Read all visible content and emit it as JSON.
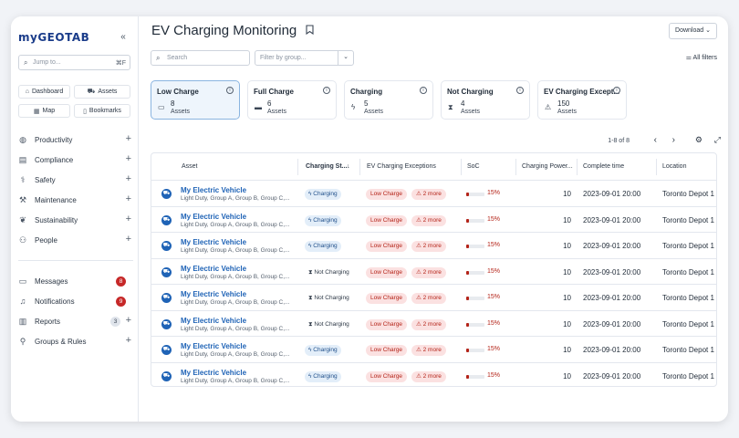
{
  "sidebar": {
    "logo": "myGEOTAB",
    "collapse_icon": "«",
    "jump": {
      "placeholder": "Jump to...",
      "shortcut": "⌘F"
    },
    "quick": [
      {
        "label": "Dashboard",
        "icon": "home-icon"
      },
      {
        "label": "Assets",
        "icon": "truck-icon"
      },
      {
        "label": "Map",
        "icon": "map-icon"
      },
      {
        "label": "Bookmarks",
        "icon": "bookmark-icon"
      }
    ],
    "nav": [
      {
        "label": "Productivity",
        "icon": "globe-icon"
      },
      {
        "label": "Compliance",
        "icon": "clipboard-icon"
      },
      {
        "label": "Safety",
        "icon": "safety-icon"
      },
      {
        "label": "Maintenance",
        "icon": "wrench-icon"
      },
      {
        "label": "Sustainability",
        "icon": "leaf-icon"
      },
      {
        "label": "People",
        "icon": "people-icon"
      }
    ],
    "nav2": [
      {
        "label": "Messages",
        "icon": "message-icon",
        "badge": "8"
      },
      {
        "label": "Notifications",
        "icon": "bell-icon",
        "badge": "9"
      },
      {
        "label": "Reports",
        "icon": "report-icon",
        "badge": "3"
      },
      {
        "label": "Groups & Rules",
        "icon": "groups-icon"
      }
    ]
  },
  "header": {
    "title": "EV Charging Monitoring",
    "download": "Download",
    "search_placeholder": "Search",
    "filter_placeholder": "Filter by group...",
    "all_filters": "All filters"
  },
  "cards": [
    {
      "label": "Low Charge",
      "count": "8",
      "unit": "Assets",
      "icon": "battery-low-icon"
    },
    {
      "label": "Full Charge",
      "count": "6",
      "unit": "Assets",
      "icon": "battery-full-icon"
    },
    {
      "label": "Charging",
      "count": "5",
      "unit": "Assets",
      "icon": "battery-charging-icon"
    },
    {
      "label": "Not Charging",
      "count": "4",
      "unit": "Assets",
      "icon": "hourglass-icon"
    },
    {
      "label": "EV Charging Except...",
      "count": "150",
      "unit": "Assets",
      "icon": "warning-icon"
    }
  ],
  "pager": {
    "text": "1-8 of 8"
  },
  "table": {
    "columns": [
      "Asset",
      "Charging St...",
      "EV Charging Exceptions",
      "SoC",
      "Charging Power...",
      "Complete time",
      "Location"
    ],
    "rows": [
      {
        "name": "My Electric Vehicle",
        "group": "Light Duty, Group A, Group B, Group C,...",
        "status": "Charging",
        "status_type": "charging",
        "exception": "Low Charge",
        "more": "2 more",
        "soc": "15%",
        "soc_value": 0.15,
        "power": "10",
        "time": "2023-09-01 20:00",
        "location": "Toronto Depot 1"
      },
      {
        "name": "My Electric Vehicle",
        "group": "Light Duty, Group A, Group B, Group C,...",
        "status": "Charging",
        "status_type": "charging",
        "exception": "Low Charge",
        "more": "2 more",
        "soc": "15%",
        "soc_value": 0.15,
        "power": "10",
        "time": "2023-09-01 20:00",
        "location": "Toronto Depot 1"
      },
      {
        "name": "My Electric Vehicle",
        "group": "Light Duty, Group A, Group B, Group C,...",
        "status": "Charging",
        "status_type": "charging",
        "exception": "Low Charge",
        "more": "2 more",
        "soc": "15%",
        "soc_value": 0.15,
        "power": "10",
        "time": "2023-09-01 20:00",
        "location": "Toronto Depot 1"
      },
      {
        "name": "My Electric Vehicle",
        "group": "Light Duty, Group A, Group B, Group C,...",
        "status": "Not Charging",
        "status_type": "notcharging",
        "exception": "Low Charge",
        "more": "2 more",
        "soc": "15%",
        "soc_value": 0.15,
        "power": "10",
        "time": "2023-09-01 20:00",
        "location": "Toronto Depot 1"
      },
      {
        "name": "My Electric Vehicle",
        "group": "Light Duty, Group A, Group B, Group C,...",
        "status": "Not Charging",
        "status_type": "notcharging",
        "exception": "Low Charge",
        "more": "2 more",
        "soc": "15%",
        "soc_value": 0.15,
        "power": "10",
        "time": "2023-09-01 20:00",
        "location": "Toronto Depot 1"
      },
      {
        "name": "My Electric Vehicle",
        "group": "Light Duty, Group A, Group B, Group C,...",
        "status": "Not Charging",
        "status_type": "notcharging",
        "exception": "Low Charge",
        "more": "2 more",
        "soc": "15%",
        "soc_value": 0.15,
        "power": "10",
        "time": "2023-09-01 20:00",
        "location": "Toronto Depot 1"
      },
      {
        "name": "My Electric Vehicle",
        "group": "Light Duty, Group A, Group B, Group C,...",
        "status": "Charging",
        "status_type": "charging",
        "exception": "Low Charge",
        "more": "2 more",
        "soc": "15%",
        "soc_value": 0.15,
        "power": "10",
        "time": "2023-09-01 20:00",
        "location": "Toronto Depot 1"
      },
      {
        "name": "My Electric Vehicle",
        "group": "Light Duty, Group A, Group B, Group C,...",
        "status": "Charging",
        "status_type": "charging",
        "exception": "Low Charge",
        "more": "2 more",
        "soc": "15%",
        "soc_value": 0.15,
        "power": "10",
        "time": "2023-09-01 20:00",
        "location": "Toronto Depot 1"
      }
    ]
  },
  "colors": {
    "brand": "#1a3c8a",
    "link": "#1f63b6",
    "danger": "#b42318",
    "active_card": "#eef5fc"
  }
}
